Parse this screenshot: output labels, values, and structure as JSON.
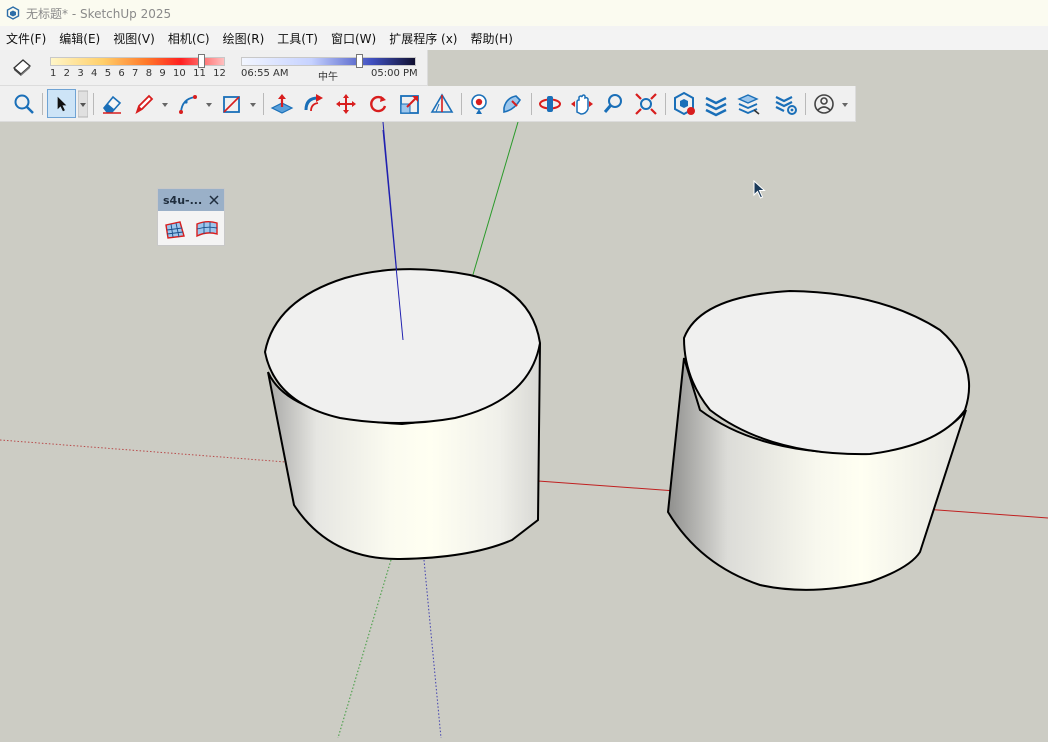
{
  "window": {
    "title": "无标题* - SketchUp 2025"
  },
  "menu": [
    "文件(F)",
    "编辑(E)",
    "视图(V)",
    "相机(C)",
    "绘图(R)",
    "工具(T)",
    "窗口(W)",
    "扩展程序 (x)",
    "帮助(H)"
  ],
  "shadows": {
    "months": [
      "1",
      "2",
      "3",
      "4",
      "5",
      "6",
      "7",
      "8",
      "9",
      "10",
      "11",
      "12"
    ],
    "month_position": 0.85,
    "time_start": "06:55 AM",
    "time_mid": "中午",
    "time_end": "05:00 PM",
    "time_position": 0.66
  },
  "toolbar_icons": [
    "search-icon",
    "select-arrow-icon",
    "eraser-icon",
    "pencil-icon",
    "arc-icon",
    "rectangle-icon",
    "push-pull-icon",
    "follow-me-icon",
    "move-icon",
    "rotate-icon",
    "scale-icon",
    "tape-measure-icon",
    "paint-bucket-icon",
    "warehouse-icon",
    "orbit-icon",
    "pan-icon",
    "zoom-icon",
    "zoom-extents-icon",
    "extension-warehouse-icon",
    "layers-icon",
    "stack-icon",
    "settings-layers-icon",
    "account-icon"
  ],
  "float_panel": {
    "title": "s4u-..."
  },
  "colors": {
    "accent_red": "#d81e1e",
    "accent_blue": "#1a6fb8",
    "viewport_bg": "#ccccc4"
  }
}
